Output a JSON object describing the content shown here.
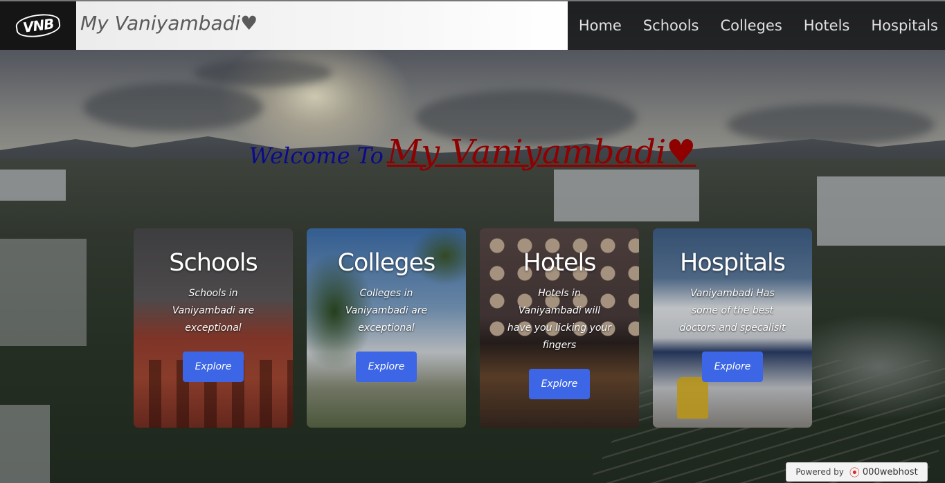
{
  "nav": {
    "logo_text": "VNB",
    "brand": "My Vaniyambadi♥",
    "links": [
      "Home",
      "Schools",
      "Colleges",
      "Hotels",
      "Hospitals"
    ]
  },
  "hero": {
    "lead": "Welcome To",
    "site": "My Vaniyambadi♥"
  },
  "cards": [
    {
      "title": "Schools",
      "desc": "Schools in Vaniyambadi are exceptional",
      "button": "Explore"
    },
    {
      "title": "Colleges",
      "desc": "Colleges in Vaniyambadi are exceptional",
      "button": "Explore"
    },
    {
      "title": "Hotels",
      "desc": "Hotels in Vaniyambadi will have you licking your fingers",
      "button": "Explore"
    },
    {
      "title": "Hospitals",
      "desc": "Vaniyambadi Has some of the best doctors and specalisit",
      "button": "Explore"
    }
  ],
  "footer": {
    "powered_label": "Powered by",
    "host_name": "000webhost",
    "host_icon": "flame-icon"
  },
  "colors": {
    "nav_bg": "#181818",
    "button": "#3c66e5",
    "heading_blue": "#0a0b8a",
    "heading_red": "#8f0000"
  }
}
